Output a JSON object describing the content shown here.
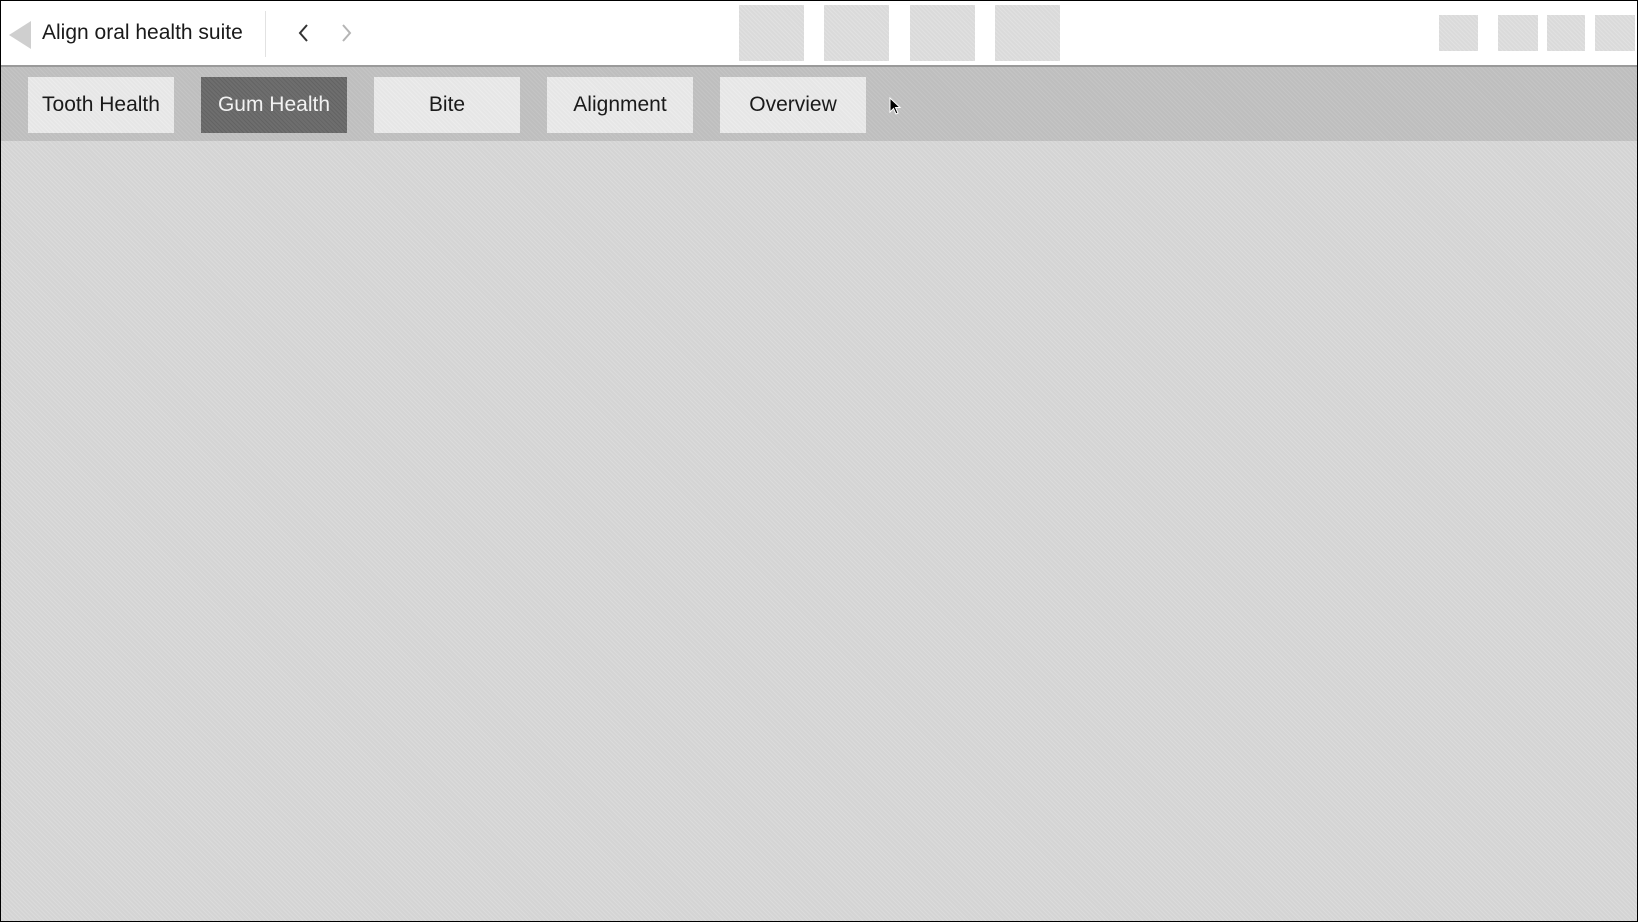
{
  "header": {
    "title": "Align oral health suite",
    "back_icon": "back-triangle-icon",
    "prev_icon": "chevron-left-icon",
    "next_icon": "chevron-right-icon"
  },
  "tabs": [
    {
      "label": "Tooth Health",
      "active": false
    },
    {
      "label": "Gum Health",
      "active": true
    },
    {
      "label": "Bite",
      "active": false
    },
    {
      "label": "Alignment",
      "active": false
    },
    {
      "label": "Overview",
      "active": false
    }
  ],
  "colors": {
    "active_tab": "#6e6e6e",
    "tab": "#e6e6e6",
    "tab_bar": "#bebebe",
    "content": "#d4d4d4"
  }
}
